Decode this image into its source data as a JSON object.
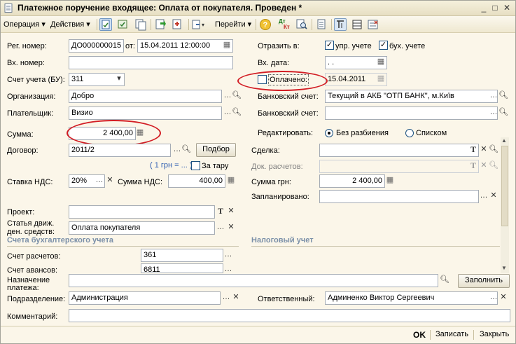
{
  "window": {
    "title": "Платежное поручение входящее: Оплата от покупателя. Проведен *"
  },
  "toolbar": {
    "operation": "Операция",
    "actions": "Действия",
    "goto": "Перейти",
    "dtkt_top": "Дт",
    "dtkt_bottom": "Кт"
  },
  "form": {
    "reg_number_label": "Рег. номер:",
    "reg_number": "ДО000000015",
    "from_label": "от:",
    "date": "15.04.2011 12:00:00",
    "reflect_label": "Отразить в:",
    "upr_label": "упр. учете",
    "buh_label": "бух. учете",
    "in_number_label": "Вх. номер:",
    "in_number": "",
    "in_date_label": "Вх. дата:",
    "in_date": " .  .",
    "account_label": "Счет учета (БУ):",
    "account": "311",
    "paid_label": "Оплачено:",
    "paid_date": "15.04.2011",
    "org_label": "Организация:",
    "org": "Добро",
    "bank_account_label": "Банковский счет:",
    "bank_account": "Текущий в АКБ \"ОТП БАНК\", м.Київ",
    "payer_label": "Плательщик:",
    "payer": "Визио",
    "payer_bank_label": "Банковский счет:",
    "payer_bank": "",
    "sum_label": "Сумма:",
    "sum": "2 400,00",
    "edit_label": "Редактировать:",
    "edit_option1": "Без разбиения",
    "edit_option2": "Списком",
    "contract_label": "Договор:",
    "contract": "2011/2",
    "select_button": "Подбор",
    "deal_label": "Сделка:",
    "deal": "",
    "rate_link": "( 1 грн = ... )",
    "for_goods_label": "За тару",
    "settle_doc_label": "Док. расчетов:",
    "settle_doc": "",
    "vat_rate_label": "Ставка НДС:",
    "vat_rate": "20%",
    "vat_sum_label": "Сумма НДС:",
    "vat_sum": "400,00",
    "sum_uah_label": "Сумма грн:",
    "sum_uah": "2 400,00",
    "planned_label": "Запланировано:",
    "planned": "",
    "project_label": "Проект:",
    "project": "",
    "cashflow_label_1": "Статья движ.",
    "cashflow_label_2": "ден. средств:",
    "cashflow": "Оплата покупателя",
    "section_accounting": "Счета бухгалтерского учета",
    "section_tax": "Налоговый учет",
    "settle_account_label": "Счет расчетов:",
    "settle_account": "361",
    "advance_account_label": "Счет авансов:",
    "advance_account": "6811",
    "purpose_label_1": "Назначение",
    "purpose_label_2": "платежа:",
    "purpose": "",
    "fill_button": "Заполнить",
    "division_label": "Подразделение:",
    "division": "Администрация",
    "responsible_label": "Ответственный:",
    "responsible": "Админенко Виктор Сергеевич",
    "comment_label": "Комментарий:",
    "comment": ""
  },
  "footer": {
    "ok": "OK",
    "save": "Записать",
    "close": "Закрыть"
  },
  "colors": {
    "background": "#fbf6e9",
    "annotation_red": "#d21d24",
    "section_text": "#7a8fa8",
    "link": "#2a5bb0"
  }
}
